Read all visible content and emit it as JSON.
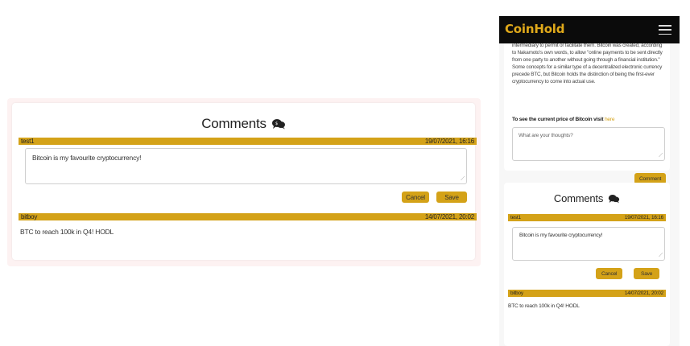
{
  "comments": {
    "title": "Comments",
    "icon": "comments-icon",
    "items": [
      {
        "user": "test1",
        "date": "19/07/2021, 16:16",
        "editing": true,
        "text": "Bitcoin is my favourite cryptocurrency!",
        "cancel_label": "Cancel",
        "save_label": "Save"
      },
      {
        "user": "bitboy",
        "date": "14/07/2021, 20:02",
        "editing": false,
        "text": "BTC to reach 100k in Q4! HODL"
      }
    ]
  },
  "mobile": {
    "brand": "CoinHold",
    "menu_icon": "hamburger-icon",
    "article_text": "intermediary to permit or facilitate them. Bitcoin was created, according to Nakamoto's own words, to allow \"online payments to be sent directly from one party to another without going through a financial institution.\" Some concepts for a similar type of a decentralized electronic currency precede BTC, but Bitcoin holds the distinction of being the first-ever cryptocurrency to come into actual use.",
    "price_prompt": "To see the current price of Bitcoin visit",
    "price_link": "here",
    "thoughts_placeholder": "What are your thoughts?",
    "comment_button": "Comment"
  },
  "colors": {
    "accent": "#d4a218",
    "navbar": "#0b0b0b",
    "brand": "#e0a91a"
  }
}
